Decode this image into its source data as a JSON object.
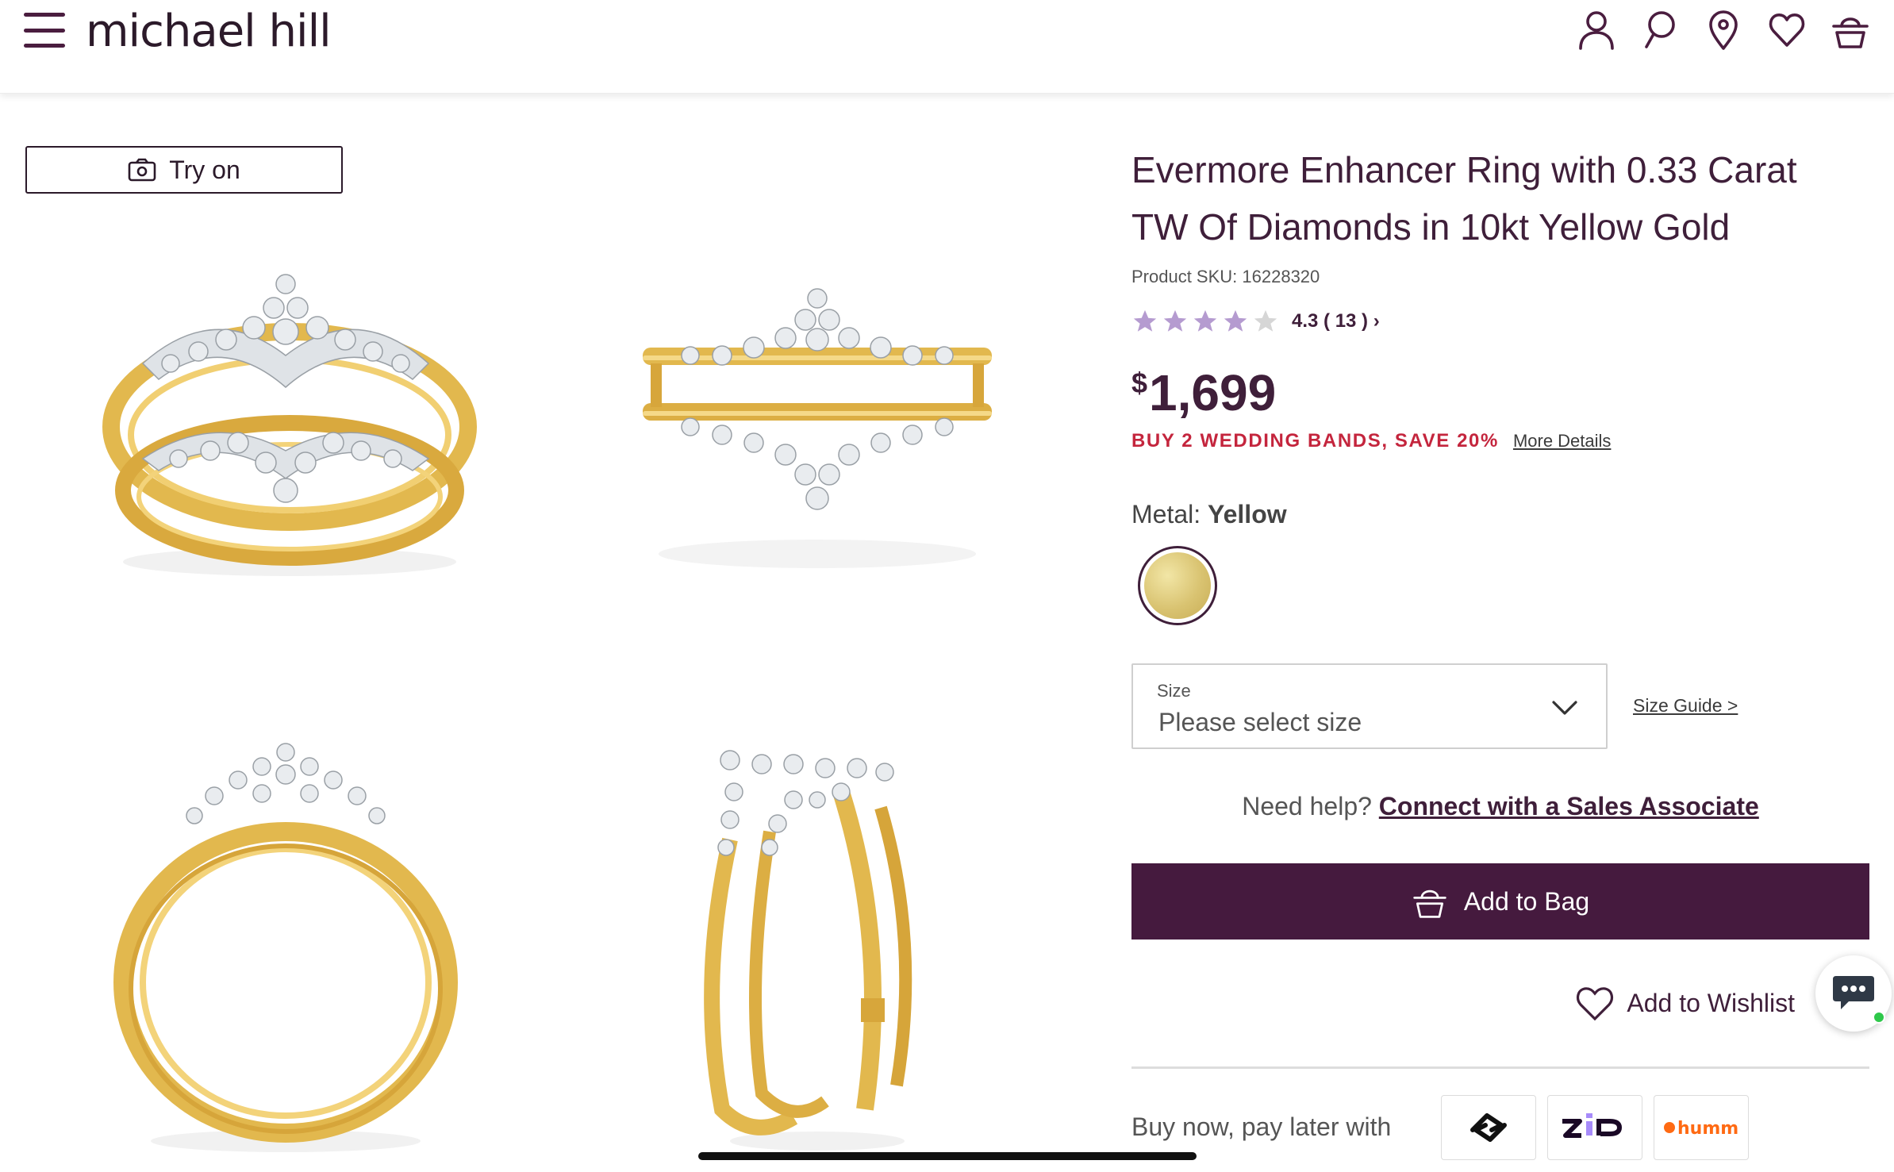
{
  "header": {
    "logo_text": "michael hill",
    "icons": [
      "user-icon",
      "search-icon",
      "location-icon",
      "heart-icon",
      "basket-icon"
    ]
  },
  "gallery": {
    "try_on_label": "Try on",
    "images": [
      "ring-front-view",
      "ring-side-view",
      "ring-profile-view",
      "ring-angle-view"
    ]
  },
  "product": {
    "title": "Evermore Enhancer Ring with 0.33 Carat TW Of Diamonds in 10kt Yellow Gold",
    "sku": "Product SKU: 16228320",
    "rating_value": 4.3,
    "rating_text": "4.3 ( 13 ) ›",
    "price_symbol": "$",
    "price_amount": "1,699",
    "promo_text": "BUY 2 WEDDING BANDS, SAVE 20%",
    "promo_link": "More Details",
    "metal_label": "Metal:",
    "metal_value": "Yellow",
    "size_label": "Size",
    "size_placeholder": "Please select size",
    "size_guide": "Size Guide >",
    "help_text": "Need help?",
    "help_link": "Connect with a Sales Associate",
    "add_to_bag": "Add to Bag",
    "add_to_wishlist": "Add to Wishlist",
    "bnpl_text": "Buy now, pay later with",
    "bnpl_providers": [
      "afterpay",
      "zip",
      "humm"
    ]
  },
  "colors": {
    "brand": "#451a3e",
    "promo": "#c4253d",
    "star_filled": "#b59bd0",
    "star_empty": "#d6d6d6",
    "gold": "#d9c371"
  }
}
